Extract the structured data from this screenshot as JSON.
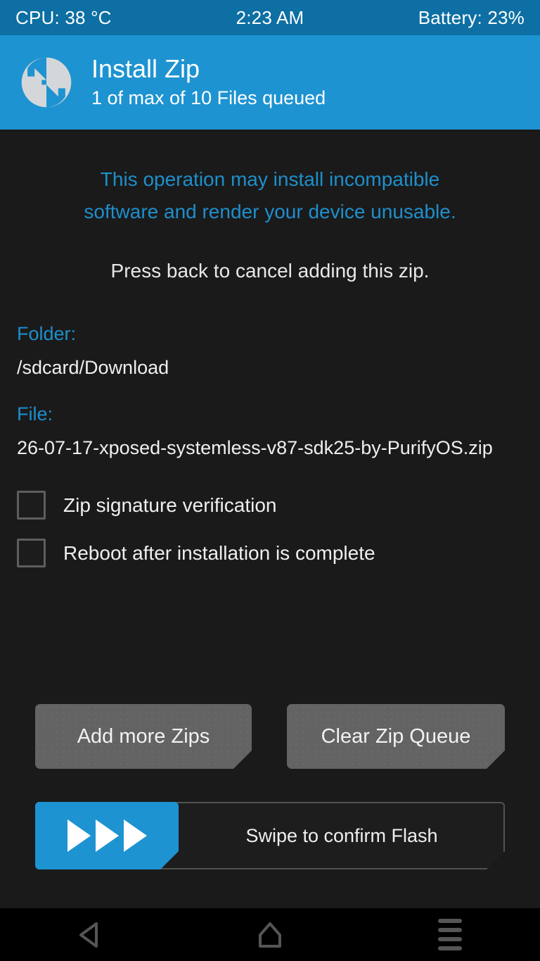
{
  "status_bar": {
    "cpu": "CPU: 38 °C",
    "time": "2:23 AM",
    "battery": "Battery: 23%"
  },
  "header": {
    "logo_icon": "twrp-logo-icon",
    "title": "Install Zip",
    "subtitle": "1 of max of 10 Files queued"
  },
  "main": {
    "warning_line1": "This operation may install incompatible",
    "warning_line2": "software and render your device unusable.",
    "cancel_hint": "Press back to cancel adding this zip.",
    "folder_label": "Folder:",
    "folder_value": "/sdcard/Download",
    "file_label": "File:",
    "file_value": "26-07-17-xposed-systemless-v87-sdk25-by-PurifyOS.zip",
    "checkboxes": [
      {
        "label": "Zip signature verification",
        "checked": false
      },
      {
        "label": "Reboot after installation is complete",
        "checked": false
      }
    ],
    "buttons": {
      "add_more_zips": "Add more Zips",
      "clear_zip_queue": "Clear Zip Queue"
    },
    "slider": {
      "label": "Swipe to confirm Flash",
      "handle_icon": "triple-play-arrow-icon",
      "progress_percent": 0
    }
  },
  "nav_bar": {
    "back_icon": "back-triangle-icon",
    "home_icon": "home-house-icon",
    "menu_icon": "menu-lines-icon"
  },
  "colors": {
    "status_bar_blue": "#0d6fa3",
    "header_blue": "#1e93d1",
    "accent_blue": "#1e8fcc",
    "background": "#1a1a1a",
    "button_gray": "#636363",
    "text_white": "#efefef"
  }
}
